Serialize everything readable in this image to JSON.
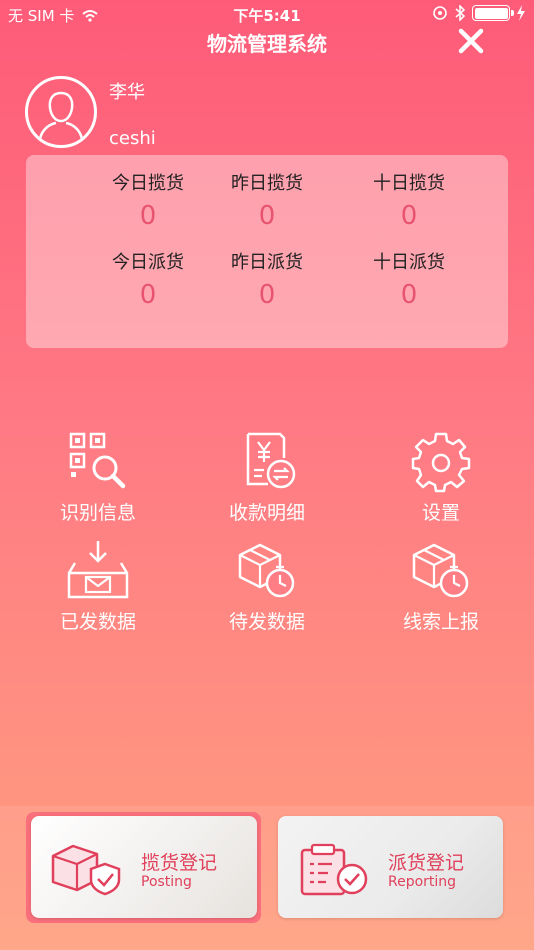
{
  "status_bar": {
    "carrier": "无 SIM 卡",
    "time": "下午5:41"
  },
  "header": {
    "title": "物流管理系统"
  },
  "profile": {
    "name": "李华",
    "id": "ceshi"
  },
  "stats": [
    {
      "label": "今日揽货",
      "value": "0"
    },
    {
      "label": "昨日揽货",
      "value": "0"
    },
    {
      "label": "十日揽货",
      "value": "0"
    },
    {
      "label": "今日派货",
      "value": "0"
    },
    {
      "label": "昨日派货",
      "value": "0"
    },
    {
      "label": "十日派货",
      "value": "0"
    }
  ],
  "menu": [
    {
      "label": "识别信息",
      "icon": "qr-scan-icon"
    },
    {
      "label": "收款明细",
      "icon": "payment-receipt-icon"
    },
    {
      "label": "设置",
      "icon": "gear-icon"
    },
    {
      "label": "已发数据",
      "icon": "outbox-mail-icon"
    },
    {
      "label": "待发数据",
      "icon": "box-timer-icon"
    },
    {
      "label": "线索上报",
      "icon": "box-timer-icon"
    }
  ],
  "actions": {
    "posting": {
      "label_cn": "揽货登记",
      "label_en": "Posting",
      "icon": "box-shield-icon"
    },
    "reporting": {
      "label_cn": "派货登记",
      "label_en": "Reporting",
      "icon": "clipboard-check-icon"
    }
  },
  "colors": {
    "accent": "#e0405b",
    "stat_value": "#e8536f"
  }
}
